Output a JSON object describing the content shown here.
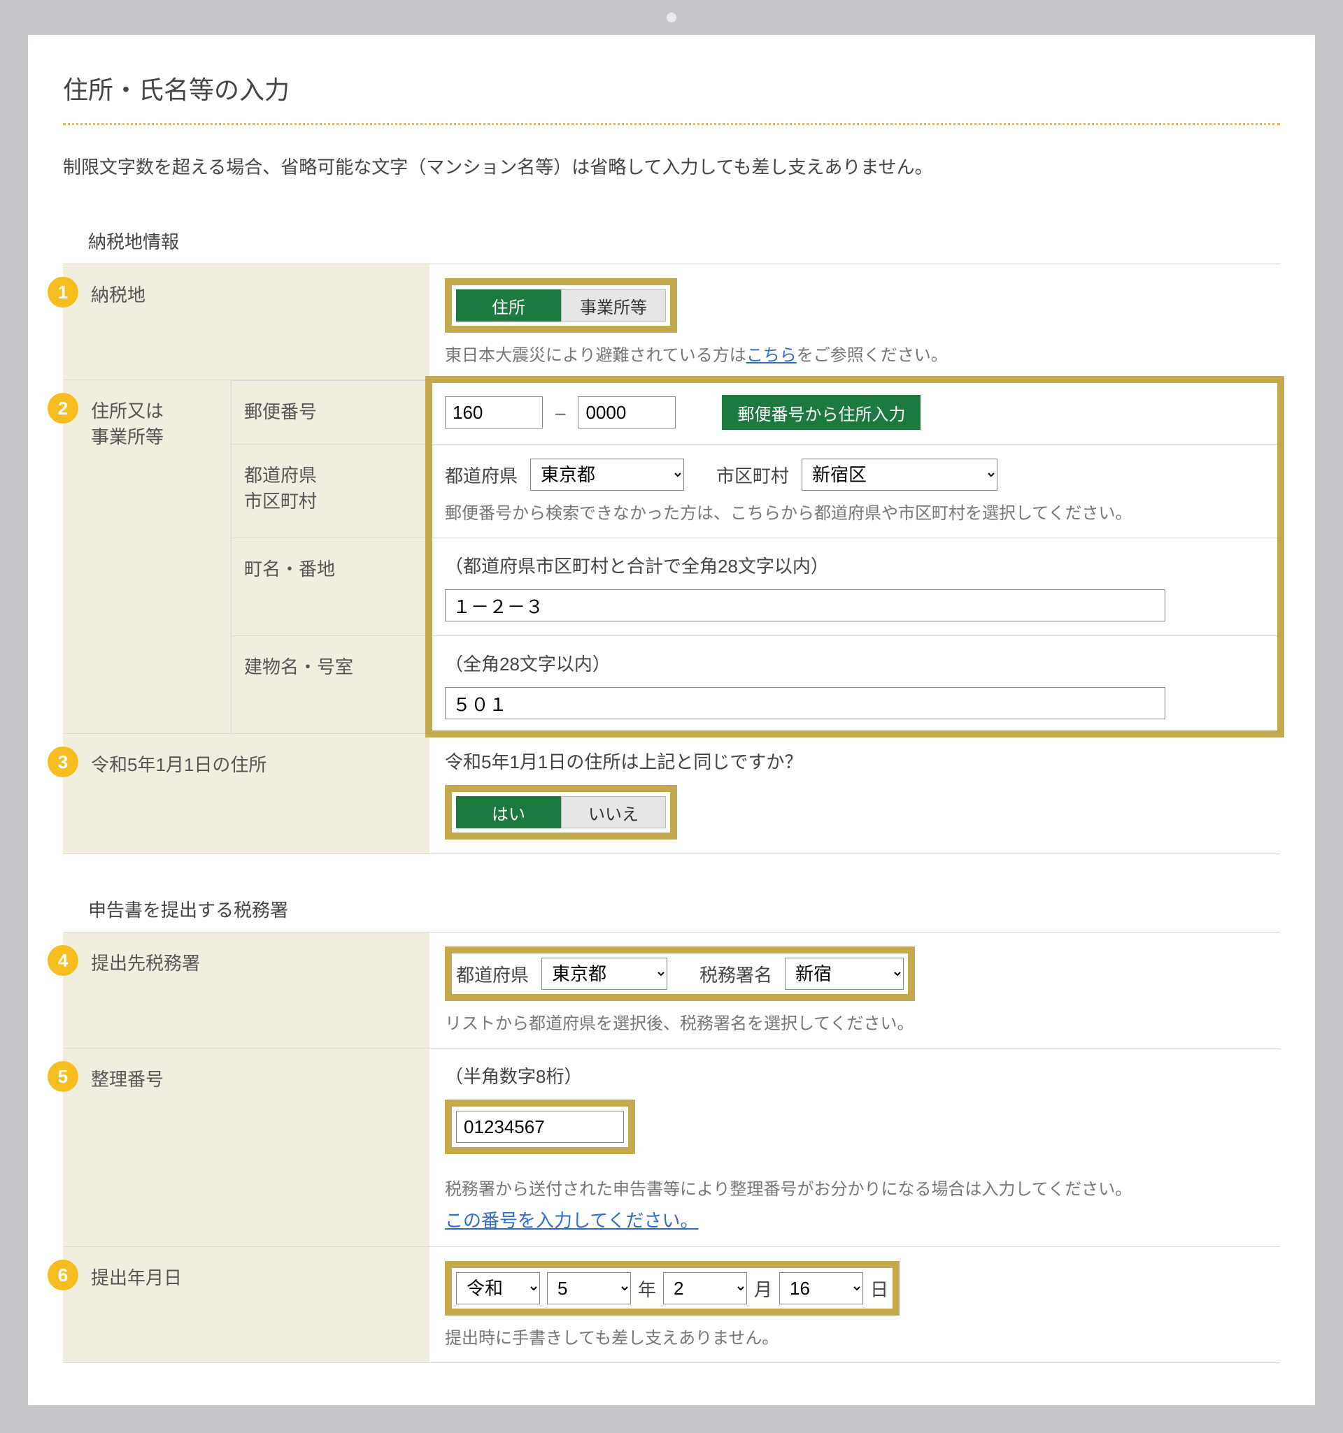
{
  "page": {
    "title": "住所・氏名等の入力",
    "intro": "制限文字数を超える場合、省略可能な文字（マンション名等）は省略して入力しても差し支えありません。"
  },
  "section1_heading": "納税地情報",
  "row1": {
    "badge": "1",
    "label": "納税地",
    "seg_address": "住所",
    "seg_office": "事業所等",
    "help_prefix": "東日本大震災により避難されている方は",
    "help_link": "こちら",
    "help_suffix": "をご参照ください。"
  },
  "row2": {
    "badge": "2",
    "label_l1": "住所又は",
    "label_l2": "事業所等",
    "postal": {
      "label": "郵便番号",
      "zip1": "160",
      "zip2": "0000",
      "button": "郵便番号から住所入力"
    },
    "pref": {
      "label": "都道府県\n市区町村",
      "pref_label": "都道府県",
      "pref_value": "東京都",
      "city_label": "市区町村",
      "city_value": "新宿区",
      "help": "郵便番号から検索できなかった方は、こちらから都道府県や市区町村を選択してください。"
    },
    "town": {
      "label": "町名・番地",
      "hint": "（都道府県市区町村と合計で全角28文字以内）",
      "value": "１－２－３"
    },
    "bldg": {
      "label": "建物名・号室",
      "hint": "（全角28文字以内）",
      "value": "５０１"
    }
  },
  "row3": {
    "badge": "3",
    "label": "令和5年1月1日の住所",
    "prompt": "令和5年1月1日の住所は上記と同じですか？",
    "yes": "はい",
    "no": "いいえ"
  },
  "section2_heading": "申告書を提出する税務署",
  "row4": {
    "badge": "4",
    "label": "提出先税務署",
    "pref_label": "都道府県",
    "pref_value": "東京都",
    "office_label": "税務署名",
    "office_value": "新宿",
    "help": "リストから都道府県を選択後、税務署名を選択してください。"
  },
  "row5": {
    "badge": "5",
    "label": "整理番号",
    "hint": "（半角数字8桁）",
    "value": "01234567",
    "help": "税務署から送付された申告書等により整理番号がお分かりになる場合は入力してください。",
    "link": "この番号を入力してください。"
  },
  "row6": {
    "badge": "6",
    "label": "提出年月日",
    "era": "令和",
    "year": "5",
    "year_suffix": "年",
    "month": "2",
    "month_suffix": "月",
    "day": "16",
    "day_suffix": "日",
    "help": "提出時に手書きしても差し支えありません。"
  }
}
